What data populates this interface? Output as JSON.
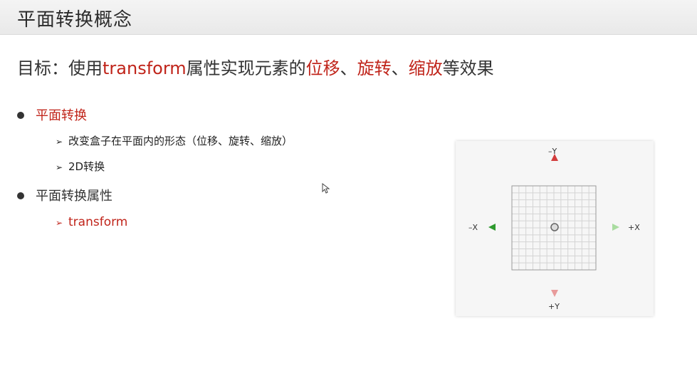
{
  "header": {
    "title": "平面转换概念"
  },
  "goal": {
    "prefix": "目标：使用",
    "keyword": "transform",
    "middle": "属性实现元素的",
    "item1": "位移",
    "sep1": "、",
    "item2": "旋转",
    "sep2": "、",
    "item3": "缩放",
    "suffix": "等效果"
  },
  "bullets": [
    {
      "label": "平面转换",
      "subitems": [
        "改变盒子在平面内的形态（位移、旋转、缩放）",
        "2D转换"
      ]
    },
    {
      "label": "平面转换属性",
      "subitems": [
        "transform"
      ]
    }
  ],
  "diagram": {
    "labels": {
      "neg_y": "–Y",
      "pos_y": "+Y",
      "neg_x": "–X",
      "pos_x": "+X"
    },
    "colors": {
      "x_axis": "#2e9a2e",
      "y_axis": "#d23c3c",
      "grid": "#cfcfcf"
    }
  },
  "icons": {
    "bullet": "filled-circle",
    "sub_bullet": "arrowhead-right",
    "cursor": "mouse-pointer-icon"
  }
}
